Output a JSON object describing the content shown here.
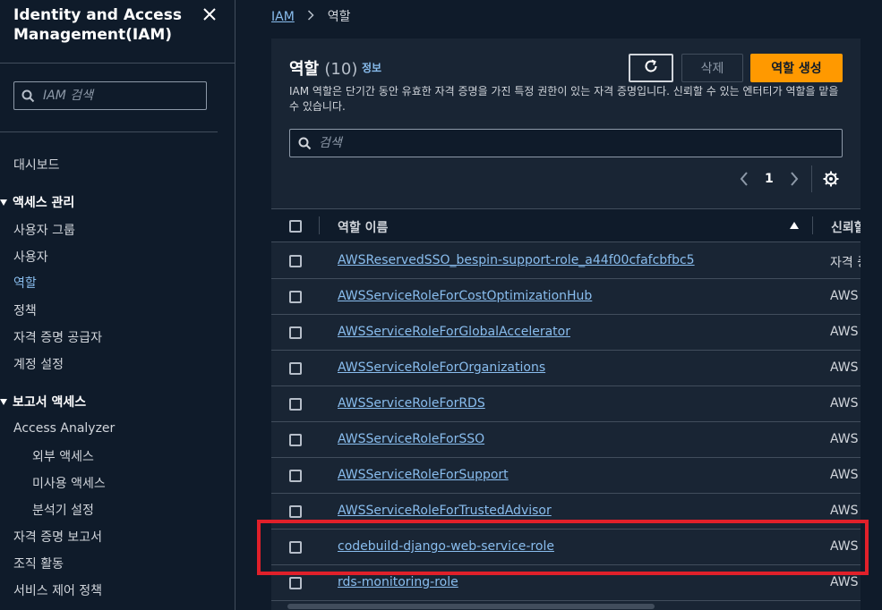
{
  "sidebar": {
    "title": "Identity and Access Management(IAM)",
    "search_placeholder": "IAM 검색",
    "dashboard": "대시보드",
    "access_mgmt": {
      "label": "액세스 관리",
      "items": [
        "사용자 그룹",
        "사용자",
        "역할",
        "정책",
        "자격 증명 공급자",
        "계정 설정"
      ]
    },
    "access_reports": {
      "label": "보고서 액세스",
      "analyzer": "Access Analyzer",
      "analyzer_items": [
        "외부 액세스",
        "미사용 액세스",
        "분석기 설정"
      ],
      "items": [
        "자격 증명 보고서",
        "조직 활동",
        "서비스 제어 정책"
      ]
    }
  },
  "breadcrumb": {
    "root": "IAM",
    "current": "역할"
  },
  "panel": {
    "title": "역할",
    "count": "(10)",
    "info": "정보",
    "description": "IAM 역할은 단기간 동안 유효한 자격 증명을 가진 특정 권한이 있는 자격 증명입니다. 신뢰할 수 있는 엔터티가 역할을 맡을 수 있습니다.",
    "delete_label": "삭제",
    "create_label": "역할 생성",
    "filter_placeholder": "검색",
    "page": "1"
  },
  "table": {
    "columns": {
      "name": "역할 이름",
      "trusted": "신뢰할"
    },
    "rows": [
      {
        "name": "AWSReservedSSO_bespin-support-role_a44f00cfafcbfbc5",
        "trusted": "자격 증"
      },
      {
        "name": "AWSServiceRoleForCostOptimizationHub",
        "trusted": "AWS"
      },
      {
        "name": "AWSServiceRoleForGlobalAccelerator",
        "trusted": "AWS"
      },
      {
        "name": "AWSServiceRoleForOrganizations",
        "trusted": "AWS"
      },
      {
        "name": "AWSServiceRoleForRDS",
        "trusted": "AWS"
      },
      {
        "name": "AWSServiceRoleForSSO",
        "trusted": "AWS"
      },
      {
        "name": "AWSServiceRoleForSupport",
        "trusted": "AWS"
      },
      {
        "name": "AWSServiceRoleForTrustedAdvisor",
        "trusted": "AWS"
      },
      {
        "name": "codebuild-django-web-service-role",
        "trusted": "AWS"
      },
      {
        "name": "rds-monitoring-role",
        "trusted": "AWS"
      }
    ]
  },
  "colors": {
    "link": "#89bdee",
    "primary": "#ff9900",
    "highlight": "#e0202a",
    "background": "#0f1b2a",
    "panel": "#192534"
  },
  "icons": [
    "close-icon",
    "search-icon",
    "refresh-icon",
    "chevron-left-icon",
    "chevron-right-icon",
    "settings-gear-icon",
    "sort-ascending-icon"
  ]
}
